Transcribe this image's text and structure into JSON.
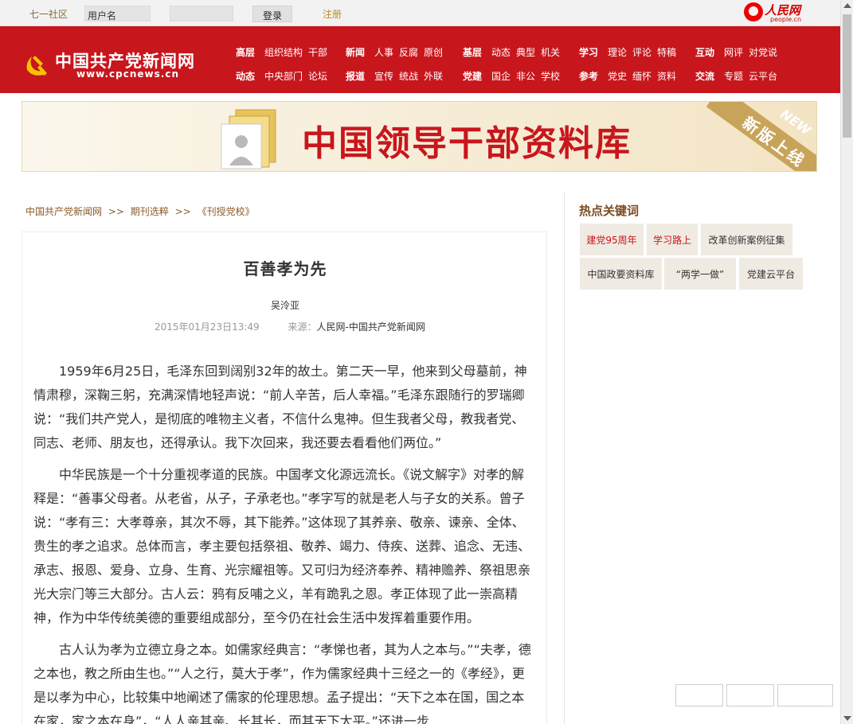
{
  "topbar": {
    "community": "七一社区",
    "username_placeholder": "用户名",
    "password_placeholder": "",
    "login_label": "登录",
    "register_label": "注册",
    "people_logo_cn": "人民网",
    "people_logo_en": "people.cn"
  },
  "header": {
    "brand_cn": "中国共产党新闻网",
    "brand_en": "www.cpcnews.cn",
    "nav_groups": [
      {
        "rows": [
          {
            "key": "高层",
            "links": [
              "组织结构",
              "干部"
            ]
          },
          {
            "key": "动态",
            "links": [
              "中央部门",
              "论坛"
            ]
          }
        ]
      },
      {
        "rows": [
          {
            "key": "新闻",
            "links": [
              "人事",
              "反腐",
              "原创"
            ]
          },
          {
            "key": "报道",
            "links": [
              "宣传",
              "统战",
              "外联"
            ]
          }
        ]
      },
      {
        "rows": [
          {
            "key": "基层",
            "links": [
              "动态",
              "典型",
              "机关"
            ]
          },
          {
            "key": "党建",
            "links": [
              "国企",
              "非公",
              "学校"
            ]
          }
        ]
      },
      {
        "rows": [
          {
            "key": "学习",
            "links": [
              "理论",
              "评论",
              "特稿"
            ]
          },
          {
            "key": "参考",
            "links": [
              "党史",
              "缅怀",
              "资料"
            ]
          }
        ]
      },
      {
        "rows": [
          {
            "key": "互动",
            "links": [
              "网评",
              "对党说"
            ]
          },
          {
            "key": "交流",
            "links": [
              "专题",
              "云平台"
            ]
          }
        ]
      }
    ]
  },
  "banner": {
    "title": "中国领导干部资料库",
    "ribbon": "新版上线",
    "badge": "NEW"
  },
  "breadcrumb": {
    "items": [
      "中国共产党新闻网",
      "期刊选粹",
      "《刊授党校》"
    ],
    "separator": ">>"
  },
  "article": {
    "title": "百善孝为先",
    "author": "吴泠亚",
    "datetime": "2015年01月23日13:49",
    "source_label": "来源：",
    "source": "人民网-中国共产党新闻网",
    "paragraphs": [
      "1959年6月25日，毛泽东回到阔别32年的故土。第二天一早，他来到父母墓前，神情肃穆，深鞠三躬，充满深情地轻声说：“前人辛苦，后人幸福。”毛泽东跟随行的罗瑞卿说：“我们共产党人，是彻底的唯物主义者，不信什么鬼神。但生我者父母，教我者党、同志、老师、朋友也，还得承认。我下次回来，我还要去看看他们两位。”",
      "中华民族是一个十分重视孝道的民族。中国孝文化源远流长。《说文解字》对孝的解释是：“善事父母者。从老省，从子，子承老也。”孝字写的就是老人与子女的关系。曾子说：“孝有三：大孝尊亲，其次不辱，其下能养。”这体现了其养亲、敬亲、谏亲、全体、贵生的孝之追求。总体而言，孝主要包括祭祖、敬养、竭力、侍疾、送葬、追念、无违、承志、报恩、爱身、立身、生育、光宗耀祖等。又可归为经济奉养、精神赡养、祭祖思亲光大宗门等三大部分。古人云：鸦有反哺之义，羊有跪乳之恩。孝正体现了此一崇高精神，作为中华传统美德的重要组成部分，至今仍在社会生活中发挥着重要作用。",
      "古人认为孝为立德立身之本。如儒家经典言：“孝悌也者，其为人之本与。”“夫孝，德之本也，教之所由生也。”“人之行，莫大于孝”，作为儒家经典十三经之一的《孝经》，更是以孝为中心，比较集中地阐述了儒家的伦理思想。孟子提出：“天下之本在国，国之本在家，家之本在身”，“人人亲其亲、长其长，而其天下太平。”还进一步"
    ]
  },
  "sidebar": {
    "hot_title": "热点关键词",
    "tags": [
      "建党95周年",
      "学习路上",
      "改革创新案例征集",
      "中国政要资料库",
      "“两学一做”",
      "党建云平台"
    ]
  },
  "colors": {
    "brand_red": "#c8161d",
    "tag_bg": "#f0ebe2",
    "heading_brown": "#7a4a1e"
  }
}
